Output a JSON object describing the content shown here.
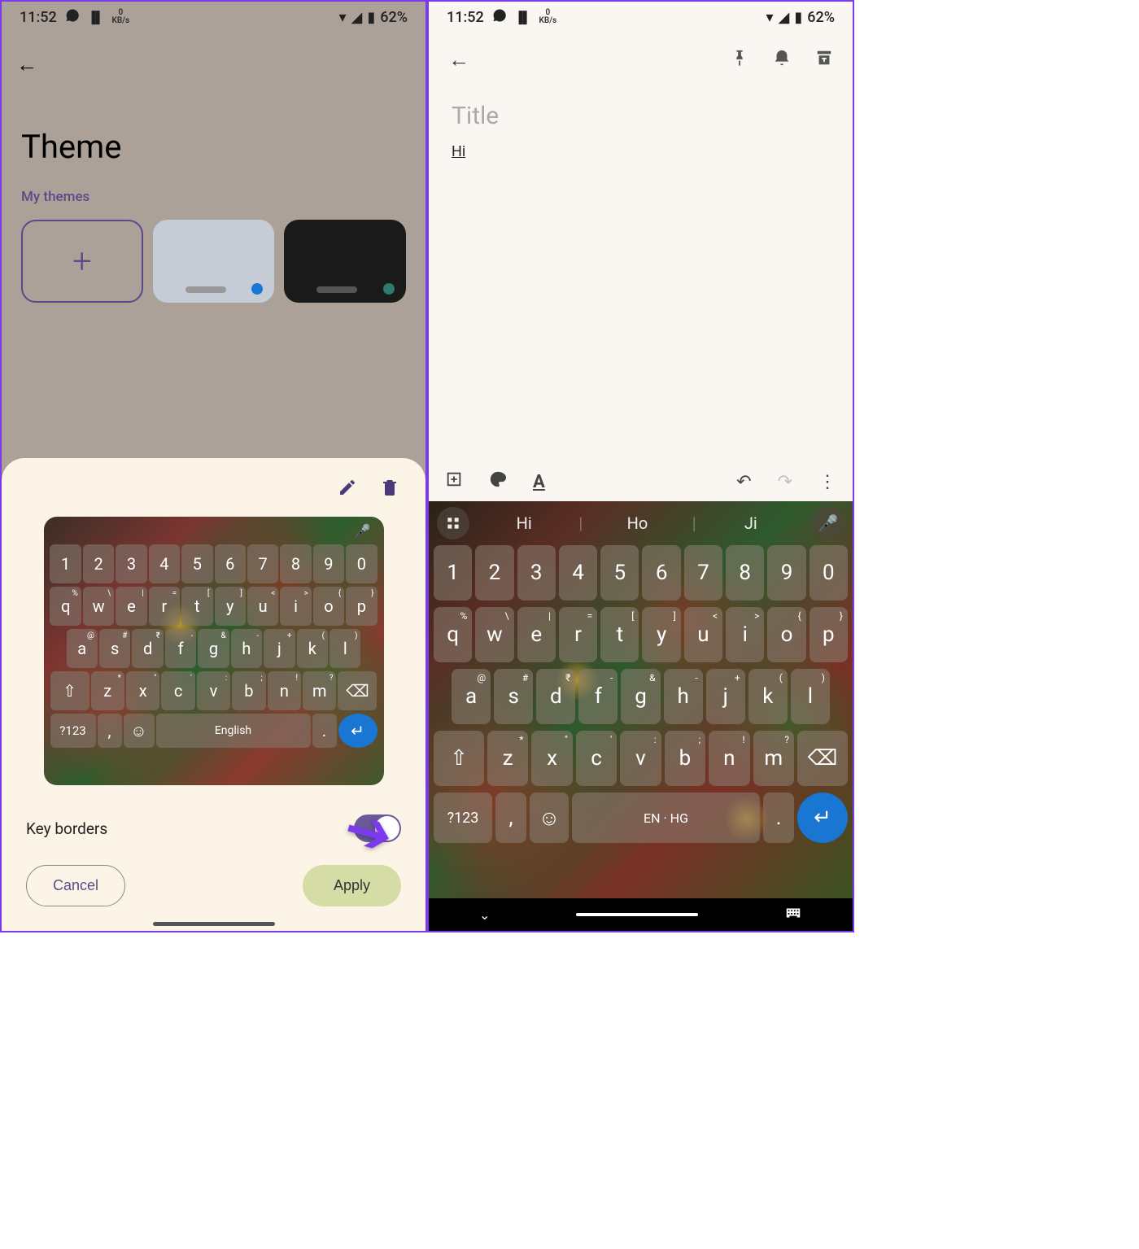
{
  "status": {
    "time": "11:52",
    "kbs_value": "0",
    "kbs_unit": "KB/s",
    "battery": "62%"
  },
  "left": {
    "page_title": "Theme",
    "section_label": "My themes",
    "sheet": {
      "numbers": [
        "1",
        "2",
        "3",
        "4",
        "5",
        "6",
        "7",
        "8",
        "9",
        "0"
      ],
      "row_q": [
        {
          "k": "q",
          "s": "%"
        },
        {
          "k": "w",
          "s": "\\"
        },
        {
          "k": "e",
          "s": "|"
        },
        {
          "k": "r",
          "s": "="
        },
        {
          "k": "t",
          "s": "["
        },
        {
          "k": "y",
          "s": "]"
        },
        {
          "k": "u",
          "s": "<"
        },
        {
          "k": "i",
          "s": ">"
        },
        {
          "k": "o",
          "s": "{"
        },
        {
          "k": "p",
          "s": "}"
        }
      ],
      "row_a": [
        {
          "k": "a",
          "s": "@"
        },
        {
          "k": "s",
          "s": "#"
        },
        {
          "k": "d",
          "s": "₹"
        },
        {
          "k": "f",
          "s": "-"
        },
        {
          "k": "g",
          "s": "&"
        },
        {
          "k": "h",
          "s": "-"
        },
        {
          "k": "j",
          "s": "+"
        },
        {
          "k": "k",
          "s": "("
        },
        {
          "k": "l",
          "s": ")"
        }
      ],
      "row_z": [
        {
          "k": "z",
          "s": "*"
        },
        {
          "k": "x",
          "s": "\""
        },
        {
          "k": "c",
          "s": "'"
        },
        {
          "k": "v",
          "s": ":"
        },
        {
          "k": "b",
          "s": ";"
        },
        {
          "k": "n",
          "s": "!"
        },
        {
          "k": "m",
          "s": "?"
        }
      ],
      "sym_key": "?123",
      "comma_key": ",",
      "space_label": "English",
      "dot_key": ".",
      "option_label": "Key borders",
      "cancel_label": "Cancel",
      "apply_label": "Apply"
    }
  },
  "right": {
    "title_placeholder": "Title",
    "note_text": "Hi",
    "suggestions": [
      "Hi",
      "Ho",
      "Ji"
    ],
    "numbers": [
      "1",
      "2",
      "3",
      "4",
      "5",
      "6",
      "7",
      "8",
      "9",
      "0"
    ],
    "row_q": [
      {
        "k": "q",
        "s": "%"
      },
      {
        "k": "w",
        "s": "\\"
      },
      {
        "k": "e",
        "s": "|"
      },
      {
        "k": "r",
        "s": "="
      },
      {
        "k": "t",
        "s": "["
      },
      {
        "k": "y",
        "s": "]"
      },
      {
        "k": "u",
        "s": "<"
      },
      {
        "k": "i",
        "s": ">"
      },
      {
        "k": "o",
        "s": "{"
      },
      {
        "k": "p",
        "s": "}"
      }
    ],
    "row_a": [
      {
        "k": "a",
        "s": "@"
      },
      {
        "k": "s",
        "s": "#"
      },
      {
        "k": "d",
        "s": "₹"
      },
      {
        "k": "f",
        "s": "-"
      },
      {
        "k": "g",
        "s": "&"
      },
      {
        "k": "h",
        "s": "-"
      },
      {
        "k": "j",
        "s": "+"
      },
      {
        "k": "k",
        "s": "("
      },
      {
        "k": "l",
        "s": ")"
      }
    ],
    "row_z": [
      {
        "k": "z",
        "s": "*"
      },
      {
        "k": "x",
        "s": "\""
      },
      {
        "k": "c",
        "s": "'"
      },
      {
        "k": "v",
        "s": ":"
      },
      {
        "k": "b",
        "s": ";"
      },
      {
        "k": "n",
        "s": "!"
      },
      {
        "k": "m",
        "s": "?"
      }
    ],
    "sym_key": "?123",
    "comma_key": ",",
    "space_label": "EN · HG",
    "dot_key": "."
  }
}
